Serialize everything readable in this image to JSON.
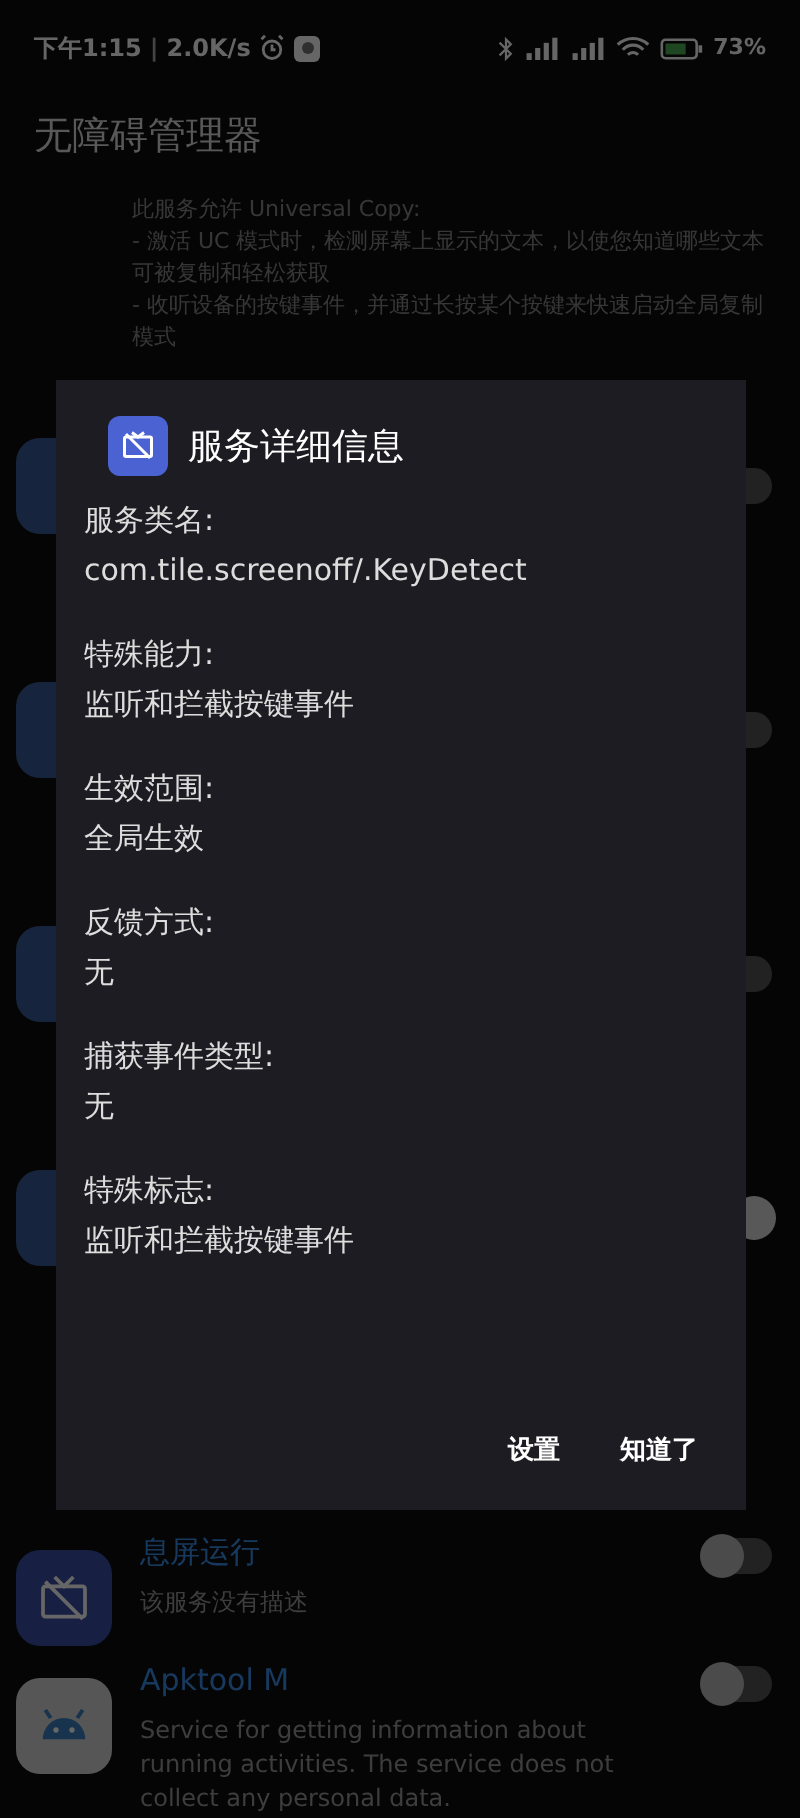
{
  "status_bar": {
    "time": "下午1:15",
    "separator": "|",
    "speed": "2.0K/s",
    "battery": "73%"
  },
  "app_title": "无障碍管理器",
  "intro_description": "此服务允许 Universal Copy:\n- 激活 UC 模式时，检测屏幕上显示的文本，以使您知道哪些文本可被复制和轻松获取\n- 收听设备的按键事件，并通过长按某个按键来快速启动全局复制模式",
  "hidden_rows": [
    {
      "on": false
    },
    {
      "on": false
    },
    {
      "on": false
    },
    {
      "on": true
    }
  ],
  "services": [
    {
      "kind": "screen",
      "name": "息屏运行",
      "description": "该服务没有描述",
      "on": false
    },
    {
      "kind": "android",
      "name": "Apktool M",
      "description": "Service for getting information about running activities. The service does not collect any personal data.",
      "on": false
    }
  ],
  "dialog": {
    "title": "服务详细信息",
    "fields": [
      {
        "label": "服务类名:",
        "value": "com.tile.screenoff/.KeyDetect"
      },
      {
        "label": "特殊能力:",
        "value": "监听和拦截按键事件"
      },
      {
        "label": "生效范围:",
        "value": "全局生效"
      },
      {
        "label": "反馈方式:",
        "value": "无"
      },
      {
        "label": "捕获事件类型:",
        "value": "无"
      },
      {
        "label": "特殊标志:",
        "value": "监听和拦截按键事件"
      }
    ],
    "buttons": [
      "设置",
      "知道了"
    ]
  }
}
